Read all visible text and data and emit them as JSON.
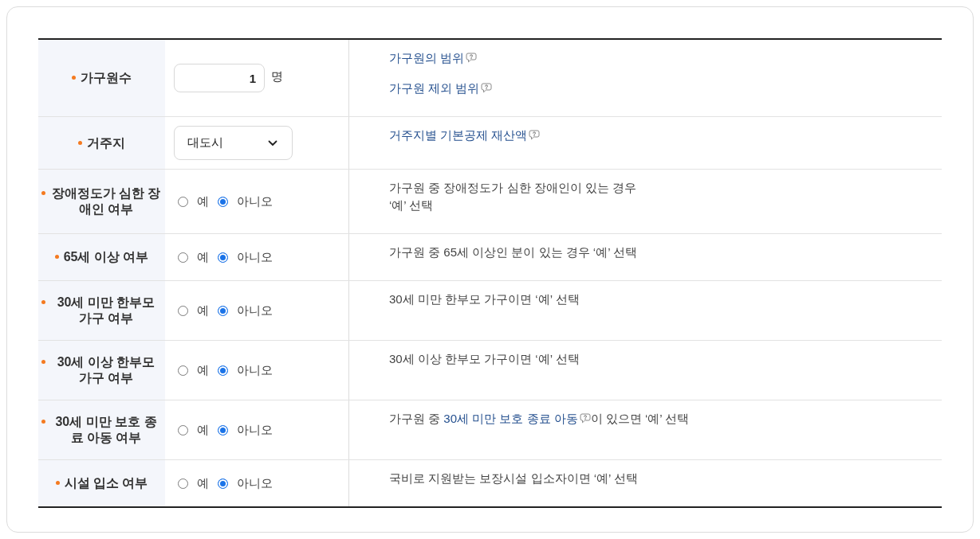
{
  "rows": [
    {
      "label": "가구원수",
      "required": true,
      "kind": "number",
      "value": "1",
      "unit": "명",
      "links": [
        {
          "text": "가구원의 범위"
        },
        {
          "text": "가구원 제외 범위"
        }
      ]
    },
    {
      "label": "거주지",
      "required": true,
      "kind": "select",
      "value": "대도시",
      "links": [
        {
          "text": "거주지별 기본공제 재산액"
        }
      ]
    },
    {
      "label": "장애정도가 심한 장애인 여부",
      "required": true,
      "kind": "radio",
      "options": [
        {
          "label": "예",
          "selected": false
        },
        {
          "label": "아니오",
          "selected": true
        }
      ],
      "description": [
        {
          "parts": [
            {
              "kind": "text",
              "text": "가구원 중 장애정도가 심한 장애인이 있는 경우"
            }
          ]
        },
        {
          "parts": [
            {
              "kind": "text",
              "text": "‘예’ 선택"
            }
          ]
        }
      ]
    },
    {
      "label": "65세 이상 여부",
      "required": true,
      "kind": "radio",
      "options": [
        {
          "label": "예",
          "selected": false
        },
        {
          "label": "아니오",
          "selected": true
        }
      ],
      "description": [
        {
          "parts": [
            {
              "kind": "text",
              "text": "가구원 중 65세 이상인 분이 있는 경우 ‘예’ 선택"
            }
          ]
        }
      ]
    },
    {
      "label": "30세 미만 한부모 가구 여부",
      "required": true,
      "kind": "radio",
      "options": [
        {
          "label": "예",
          "selected": false
        },
        {
          "label": "아니오",
          "selected": true
        }
      ],
      "description": [
        {
          "parts": [
            {
              "kind": "text",
              "text": "30세 미만 한부모 가구이면 ‘예’ 선택"
            }
          ]
        }
      ]
    },
    {
      "label": "30세 이상 한부모 가구 여부",
      "required": true,
      "kind": "radio",
      "options": [
        {
          "label": "예",
          "selected": false
        },
        {
          "label": "아니오",
          "selected": true
        }
      ],
      "description": [
        {
          "parts": [
            {
              "kind": "text",
              "text": "30세 이상 한부모 가구이면 ‘예’ 선택"
            }
          ]
        }
      ]
    },
    {
      "label": "30세 미만 보호 종료 아동 여부",
      "required": true,
      "kind": "radio",
      "options": [
        {
          "label": "예",
          "selected": false
        },
        {
          "label": "아니오",
          "selected": true
        }
      ],
      "description": [
        {
          "parts": [
            {
              "kind": "text",
              "text": "가구원 중 "
            },
            {
              "kind": "link",
              "text": "30세 미만 보호 종료 아동"
            },
            {
              "kind": "text",
              "text": "이 있으면 ‘예’ 선택"
            }
          ]
        }
      ]
    },
    {
      "label": "시설 입소 여부",
      "required": true,
      "kind": "radio",
      "options": [
        {
          "label": "예",
          "selected": false
        },
        {
          "label": "아니오",
          "selected": true
        }
      ],
      "description": [
        {
          "parts": [
            {
              "kind": "text",
              "text": "국비로 지원받는 보장시설 입소자이면 ‘예’ 선택"
            }
          ]
        }
      ]
    }
  ]
}
